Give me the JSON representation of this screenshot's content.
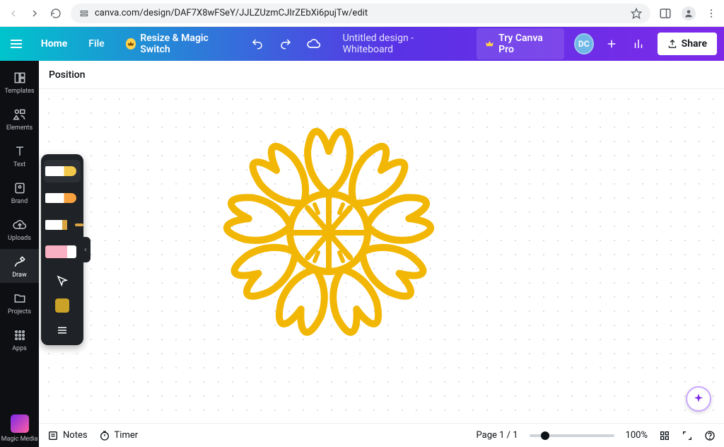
{
  "browser": {
    "url": "canva.com/design/DAF7X8wFSeY/JJLZUzmCJIrZEbXi6pujTw/edit"
  },
  "appbar": {
    "home": "Home",
    "file": "File",
    "resize": "Resize & Magic Switch",
    "title": "Untitled design - Whiteboard",
    "try_pro": "Try Canva Pro",
    "initials": "DC",
    "share": "Share"
  },
  "context": {
    "position": "Position"
  },
  "sidebar": {
    "items": [
      {
        "label": "Templates"
      },
      {
        "label": "Elements"
      },
      {
        "label": "Text"
      },
      {
        "label": "Brand"
      },
      {
        "label": "Uploads"
      },
      {
        "label": "Draw"
      },
      {
        "label": "Projects"
      },
      {
        "label": "Apps"
      }
    ],
    "magic": "Magic Media"
  },
  "draw_panel": {
    "active_color": "#c9a227"
  },
  "bottom": {
    "notes": "Notes",
    "timer": "Timer",
    "page": "Page 1 / 1",
    "zoom_pct": "100%",
    "zoom_value": 100,
    "zoom_min": 10,
    "zoom_max": 500
  }
}
